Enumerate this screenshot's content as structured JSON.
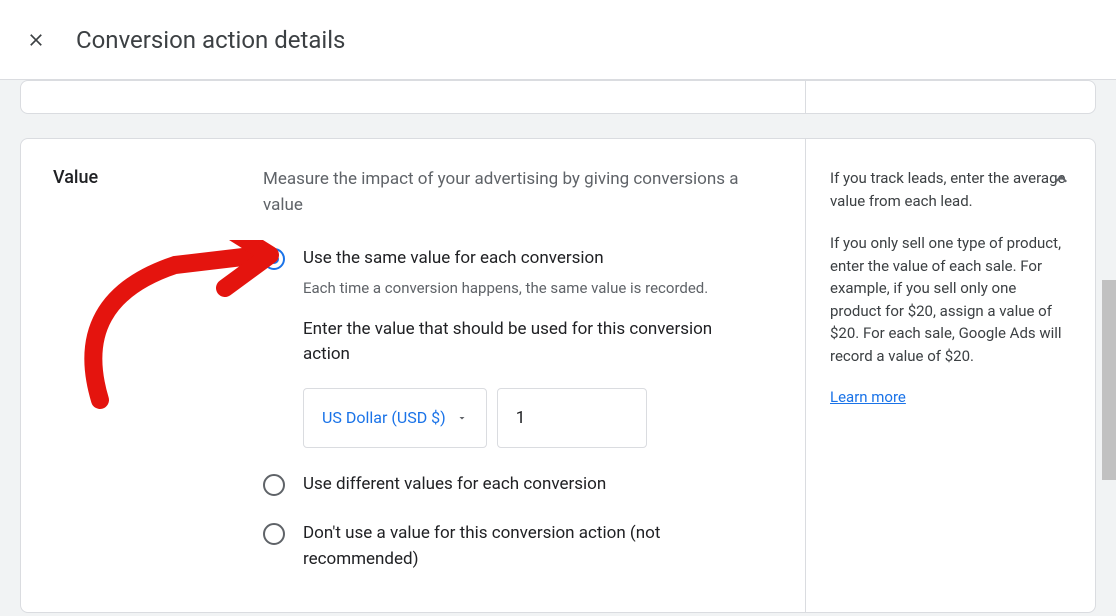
{
  "header": {
    "title": "Conversion action details"
  },
  "section": {
    "label": "Value",
    "description": "Measure the impact of your advertising by giving conversions a value"
  },
  "options": {
    "same": {
      "label": "Use the same value for each conversion",
      "sub": "Each time a conversion happens, the same value is recorded.",
      "instruct": "Enter the value that should be used for this conversion action"
    },
    "different": {
      "label": "Use different values for each conversion"
    },
    "none": {
      "label": "Don't use a value for this conversion action (not recommended)"
    }
  },
  "inputs": {
    "currency_label": "US Dollar (USD $)",
    "value": "1"
  },
  "side": {
    "leads": "If you track leads, enter the average value from each lead.",
    "products": "If you only sell one type of product, enter the value of each sale. For example, if you sell only one product for $20, assign a value of $20. For each sale, Google Ads will record a value of $20.",
    "learn_more": "Learn more"
  }
}
